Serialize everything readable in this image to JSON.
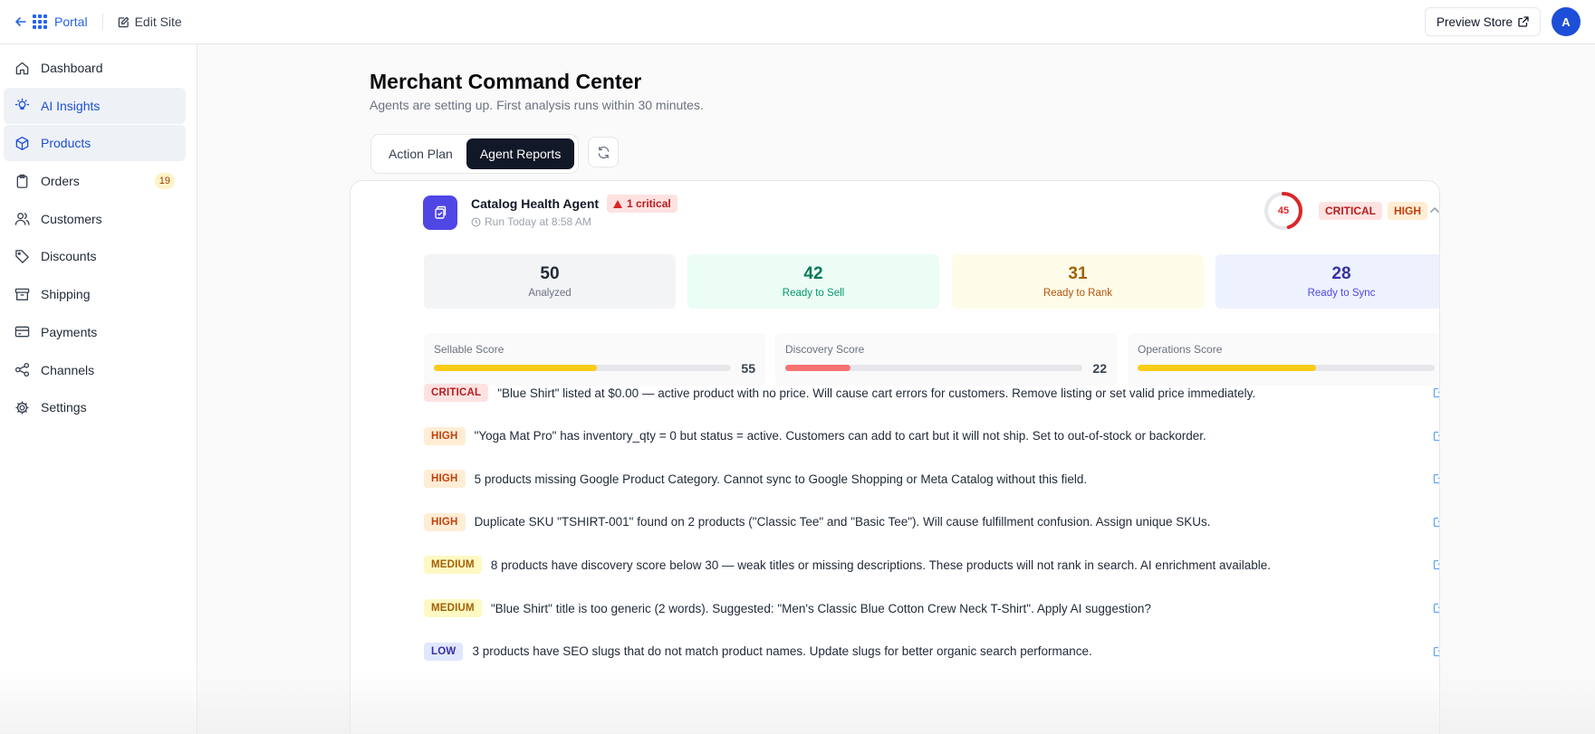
{
  "topbar": {
    "portal_label": "Portal",
    "edit_site_label": "Edit Site",
    "preview_store_label": "Preview Store",
    "avatar_initial": "A"
  },
  "sidebar": {
    "items": [
      {
        "label": "Dashboard",
        "icon": "home-icon",
        "active": false
      },
      {
        "label": "AI Insights",
        "icon": "lightbulb-icon",
        "active": true
      },
      {
        "label": "Products",
        "icon": "box-icon",
        "active": true
      },
      {
        "label": "Orders",
        "icon": "clipboard-icon",
        "active": false,
        "badge": "19"
      },
      {
        "label": "Customers",
        "icon": "users-icon",
        "active": false
      },
      {
        "label": "Discounts",
        "icon": "tag-icon",
        "active": false
      },
      {
        "label": "Shipping",
        "icon": "archive-icon",
        "active": false
      },
      {
        "label": "Payments",
        "icon": "credit-card-icon",
        "active": false
      },
      {
        "label": "Channels",
        "icon": "share-icon",
        "active": false
      },
      {
        "label": "Settings",
        "icon": "gear-icon",
        "active": false
      }
    ]
  },
  "main": {
    "title": "Merchant Command Center",
    "subtitle": "Agents are setting up. First analysis runs within 30 minutes.",
    "tabs": [
      {
        "label": "Action Plan",
        "active": false
      },
      {
        "label": "Agent Reports",
        "active": true
      }
    ]
  },
  "agent": {
    "name": "Catalog Health Agent",
    "critical_badge": "1 critical",
    "run_time": "Run Today at 8:58 AM",
    "score": "45",
    "score_fraction": 0.45,
    "severity_tags": [
      "CRITICAL",
      "HIGH"
    ],
    "stats": [
      {
        "value": "50",
        "label": "Analyzed"
      },
      {
        "value": "42",
        "label": "Ready to Sell"
      },
      {
        "value": "31",
        "label": "Ready to Rank"
      },
      {
        "value": "28",
        "label": "Ready to Sync"
      }
    ],
    "scores": [
      {
        "name": "Sellable Score",
        "value": "55",
        "percent": 55,
        "color": "#facc15"
      },
      {
        "name": "Discovery Score",
        "value": "22",
        "percent": 22,
        "color": "#f87171"
      },
      {
        "name": "Operations Score",
        "value": "60",
        "percent": 60,
        "color": "#facc15"
      }
    ],
    "issues": [
      {
        "severity": "CRITICAL",
        "text": "\"Blue Shirt\" listed at $0.00 — active product with no price. Will cause cart errors for customers. Remove listing or set valid price immediately."
      },
      {
        "severity": "HIGH",
        "text": "\"Yoga Mat Pro\" has inventory_qty = 0 but status = active. Customers can add to cart but it will not ship. Set to out-of-stock or backorder."
      },
      {
        "severity": "HIGH",
        "text": "5 products missing Google Product Category. Cannot sync to Google Shopping or Meta Catalog without this field."
      },
      {
        "severity": "HIGH",
        "text": "Duplicate SKU \"TSHIRT-001\" found on 2 products (\"Classic Tee\" and \"Basic Tee\"). Will cause fulfillment confusion. Assign unique SKUs."
      },
      {
        "severity": "MEDIUM",
        "text": "8 products have discovery score below 30 — weak titles or missing descriptions. These products will not rank in search. AI enrichment available."
      },
      {
        "severity": "MEDIUM",
        "text": "\"Blue Shirt\" title is too generic (2 words). Suggested: \"Men's Classic Blue Cotton Crew Neck T-Shirt\". Apply AI suggestion?"
      },
      {
        "severity": "LOW",
        "text": "3 products have SEO slugs that do not match product names. Update slugs for better organic search performance."
      }
    ]
  },
  "colors": {
    "accent": "#2563eb",
    "primary_dark": "#111827",
    "critical": "#dc2626",
    "agent_icon_bg": "#4f46e5"
  }
}
